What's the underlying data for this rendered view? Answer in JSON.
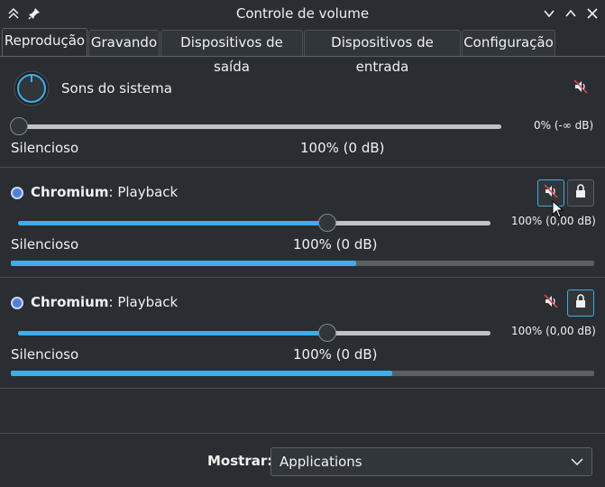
{
  "window": {
    "title": "Controle de volume"
  },
  "tabs": [
    {
      "label": "Reprodução",
      "active": true
    },
    {
      "label": "Gravando",
      "active": false
    },
    {
      "label": "Dispositivos de saída",
      "active": false
    },
    {
      "label": "Dispositivos de entrada",
      "active": false
    },
    {
      "label": "Configuração",
      "active": false
    }
  ],
  "system_sounds": {
    "name": "Sons do sistema",
    "level_text": "0% (-∞ dB)",
    "min_label": "Silencioso",
    "center_label": "100% (0 dB)",
    "volume_fraction": 0.0
  },
  "streams": [
    {
      "app": "Chromium",
      "separator": ": ",
      "stream": "Playback",
      "level_text": "100% (0,00 dB)",
      "min_label": "Silencioso",
      "center_label": "100% (0 dB)",
      "volume_fraction": 0.655,
      "peak_fraction": 0.592
    },
    {
      "app": "Chromium",
      "separator": ": ",
      "stream": "Playback",
      "level_text": "100% (0,00 dB)",
      "min_label": "Silencioso",
      "center_label": "100% (0 dB)",
      "volume_fraction": 0.655,
      "peak_fraction": 0.654
    }
  ],
  "footer": {
    "show_label": "Mostrar:",
    "selected_option": "Applications"
  },
  "colors": {
    "accent": "#3daee9",
    "background": "#2a2e32",
    "text": "#eff0f1"
  }
}
